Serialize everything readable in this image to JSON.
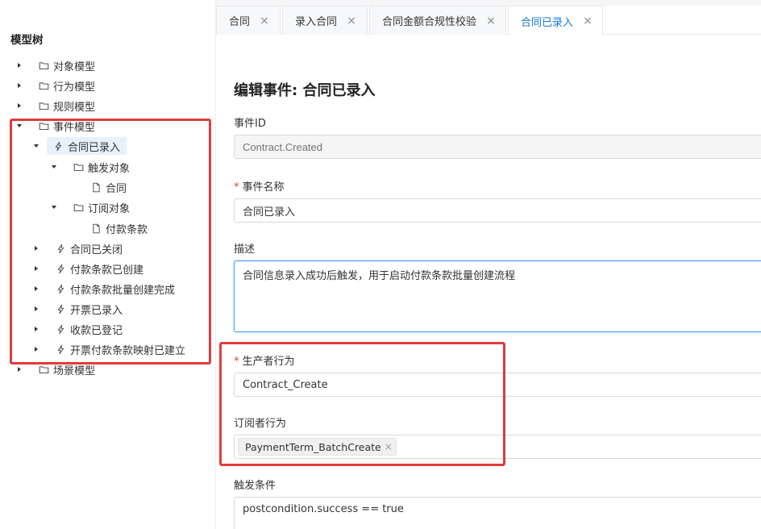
{
  "left_panel": {
    "title": "模型树",
    "tree": [
      {
        "label": "对象模型",
        "icon": "folder-icon",
        "expanded": false
      },
      {
        "label": "行为模型",
        "icon": "folder-icon",
        "expanded": false
      },
      {
        "label": "规则模型",
        "icon": "folder-icon",
        "expanded": false
      },
      {
        "label": "事件模型",
        "icon": "folder-icon",
        "expanded": true
      },
      {
        "label": "合同已录入",
        "icon": "lightning-icon",
        "expanded": true,
        "selected": true
      },
      {
        "label": "触发对象",
        "icon": "folder-icon",
        "expanded": true
      },
      {
        "label": "合同",
        "icon": "file-icon"
      },
      {
        "label": "订阅对象",
        "icon": "folder-icon",
        "expanded": true
      },
      {
        "label": "付款条款",
        "icon": "file-icon"
      },
      {
        "label": "合同已关闭",
        "icon": "lightning-icon",
        "expanded": false
      },
      {
        "label": "付款条款已创建",
        "icon": "lightning-icon",
        "expanded": false
      },
      {
        "label": "付款条款批量创建完成",
        "icon": "lightning-icon",
        "expanded": false
      },
      {
        "label": "开票已录入",
        "icon": "lightning-icon",
        "expanded": false
      },
      {
        "label": "收款已登记",
        "icon": "lightning-icon",
        "expanded": false
      },
      {
        "label": "开票付款条款映射已建立",
        "icon": "lightning-icon",
        "expanded": false
      },
      {
        "label": "场景模型",
        "icon": "folder-icon",
        "expanded": false
      }
    ]
  },
  "tabs": [
    {
      "label": "合同",
      "active": false
    },
    {
      "label": "录入合同",
      "active": false
    },
    {
      "label": "合同金额合规性校验",
      "active": false
    },
    {
      "label": "合同已录入",
      "active": true
    }
  ],
  "form": {
    "title": "编辑事件: 合同已录入",
    "event_id": {
      "label": "事件ID",
      "placeholder": "Contract.Created"
    },
    "event_name": {
      "label": "事件名称",
      "required": true,
      "value": "合同已录入"
    },
    "description": {
      "label": "描述",
      "value": "合同信息录入成功后触发，用于启动付款条款批量创建流程"
    },
    "producer": {
      "label": "生产者行为",
      "required": true,
      "value": "Contract_Create"
    },
    "subscriber": {
      "label": "订阅者行为",
      "tags": [
        "PaymentTerm_BatchCreate"
      ]
    },
    "trigger": {
      "label": "触发条件",
      "value": "postcondition.success == true"
    }
  },
  "colors": {
    "accent": "#1677d2",
    "highlight_box": "#e23b3b",
    "selected_bg": "#e6f1fc"
  }
}
